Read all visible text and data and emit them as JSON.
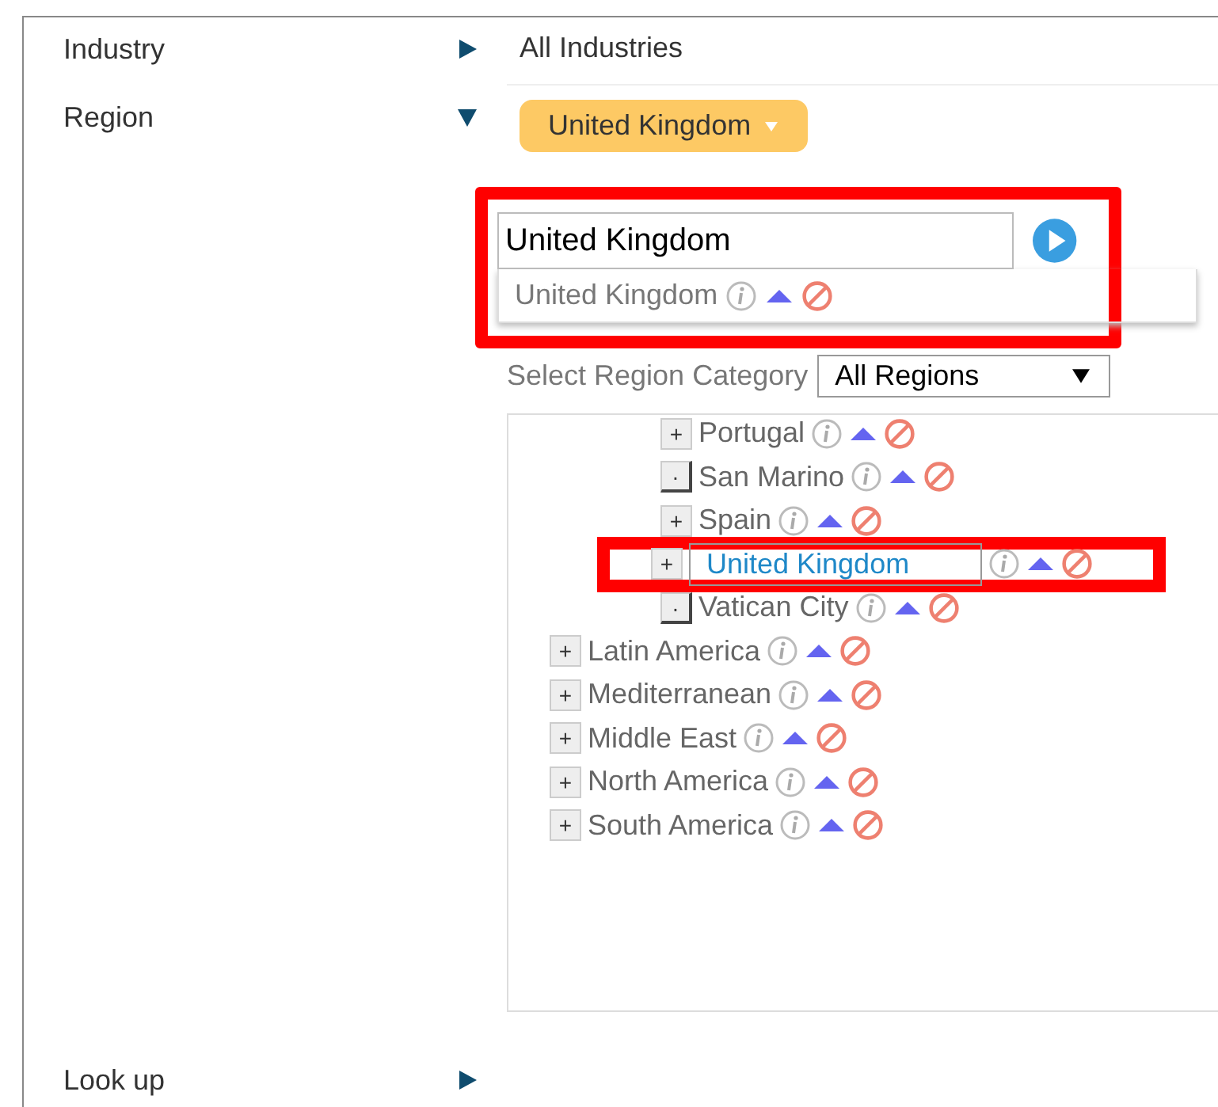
{
  "fields": [
    {
      "label": "Industry",
      "expanded": false,
      "value": "All Industries"
    },
    {
      "label": "Region",
      "expanded": true,
      "chip": "United Kingdom"
    }
  ],
  "search_panel": {
    "highlighted": true,
    "value": "United Kingdom",
    "suggestions": [
      {
        "label": "United Kingdom"
      }
    ]
  },
  "region_category": {
    "label": "Select Region Category",
    "value": "All Regions"
  },
  "tree": {
    "nested_items": [
      {
        "label": "Portugal",
        "expander": "+",
        "kind": "branch",
        "selected": false,
        "highlighted": false
      },
      {
        "label": "San Marino",
        "expander": "·",
        "kind": "leaf",
        "selected": false,
        "highlighted": false
      },
      {
        "label": "Spain",
        "expander": "+",
        "kind": "branch",
        "selected": false,
        "highlighted": false
      },
      {
        "label": "United Kingdom",
        "expander": "+",
        "kind": "branch",
        "selected": true,
        "highlighted": true
      },
      {
        "label": "Vatican City",
        "expander": "·",
        "kind": "leaf",
        "selected": false,
        "highlighted": false
      }
    ],
    "items": [
      {
        "label": "Latin America",
        "expander": "+",
        "kind": "branch",
        "selected": false,
        "highlighted": false
      },
      {
        "label": "Mediterranean",
        "expander": "+",
        "kind": "branch",
        "selected": false,
        "highlighted": false
      },
      {
        "label": "Middle East",
        "expander": "+",
        "kind": "branch",
        "selected": false,
        "highlighted": false
      },
      {
        "label": "North America",
        "expander": "+",
        "kind": "branch",
        "selected": false,
        "highlighted": false
      },
      {
        "label": "South America",
        "expander": "+",
        "kind": "branch",
        "selected": false,
        "highlighted": false
      }
    ]
  },
  "lookup": {
    "label": "Look up",
    "expanded": false
  }
}
